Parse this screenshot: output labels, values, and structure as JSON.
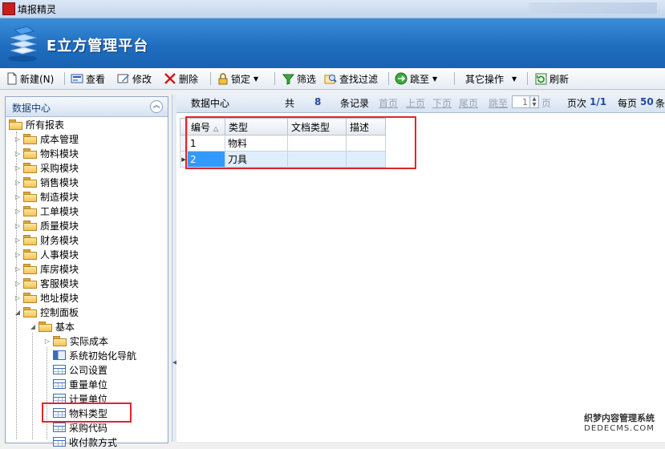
{
  "window": {
    "title": "填报精灵"
  },
  "banner": {
    "brand": "E立方管理平台"
  },
  "toolbar": {
    "new": "新建(N)",
    "view": "查看",
    "edit": "修改",
    "delete": "删除",
    "lock": "锁定",
    "filter": "筛选",
    "find_filter": "查找过滤",
    "jump": "跳至",
    "other_ops": "其它操作",
    "refresh": "刷新"
  },
  "sidebar": {
    "title": "数据中心",
    "root": "所有报表",
    "modules": [
      "成本管理",
      "物料模块",
      "采购模块",
      "销售模块",
      "制造模块",
      "工单模块",
      "质量模块",
      "财务模块",
      "人事模块",
      "库房模块",
      "客服模块",
      "地址模块",
      "控制面板"
    ],
    "basic": "基本",
    "basic_children": [
      "实际成本",
      "系统初始化导航",
      "公司设置",
      "重量单位",
      "计量单位",
      "物料类型",
      "采购代码",
      "收付款方式"
    ]
  },
  "grid_header": {
    "section": "数据中心",
    "total_label": "共",
    "total_count": "8",
    "records_label": "条记录",
    "first": "首页",
    "prev": "上页",
    "next": "下页",
    "last": "尾页",
    "jump_to": "跳至",
    "page_input": "1",
    "page_suffix": "页",
    "page_label": "页次",
    "page_value": "1/1",
    "per_page_label": "每页",
    "per_page_value": "50",
    "per_page_suffix": "条"
  },
  "grid": {
    "columns": [
      "编号",
      "类型",
      "文档类型",
      "描述"
    ],
    "rows": [
      {
        "id": "1",
        "type": "物料",
        "doc_type": "",
        "desc": ""
      },
      {
        "id": "2",
        "type": "刀具",
        "doc_type": "",
        "desc": ""
      }
    ]
  },
  "watermark": {
    "line1": "织梦内容管理系统",
    "line2": "DEDECMS.COM"
  }
}
